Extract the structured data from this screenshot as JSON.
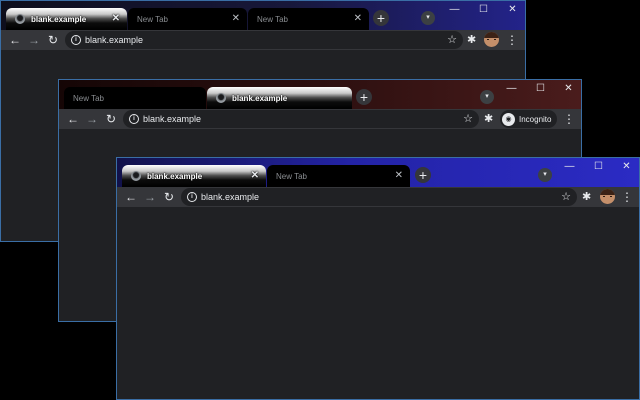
{
  "windows": [
    {
      "tabs": [
        {
          "title": "blank.example",
          "active": true
        },
        {
          "title": "New Tab",
          "active": false
        },
        {
          "title": "New Tab",
          "active": false
        }
      ],
      "omnibox": {
        "url": "blank.example"
      }
    },
    {
      "tabs": [
        {
          "title": "New Tab",
          "active": false
        },
        {
          "title": "blank.example",
          "active": true
        }
      ],
      "omnibox": {
        "url": "blank.example"
      },
      "incognito_label": "Incognito"
    },
    {
      "tabs": [
        {
          "title": "blank.example",
          "active": true
        },
        {
          "title": "New Tab",
          "active": false
        }
      ],
      "omnibox": {
        "url": "blank.example"
      }
    }
  ],
  "icons": {
    "back": "←",
    "forward": "→",
    "reload": "↻",
    "new_tab": "+",
    "tab_close": "✕",
    "tab_search": "▾",
    "minimize": "—",
    "maximize": "☐",
    "close": "✕",
    "star": "☆",
    "extensions": "✱",
    "menu": "⋮",
    "info": "i",
    "incognito": "◉"
  },
  "colors": {
    "window1_frame": "#23238a",
    "window2_frame": "#4a1c1c",
    "window3_frame": "#2b2bc4",
    "toolbar": "#35363a",
    "content": "#202124",
    "window_border": "#3a6ea5"
  }
}
